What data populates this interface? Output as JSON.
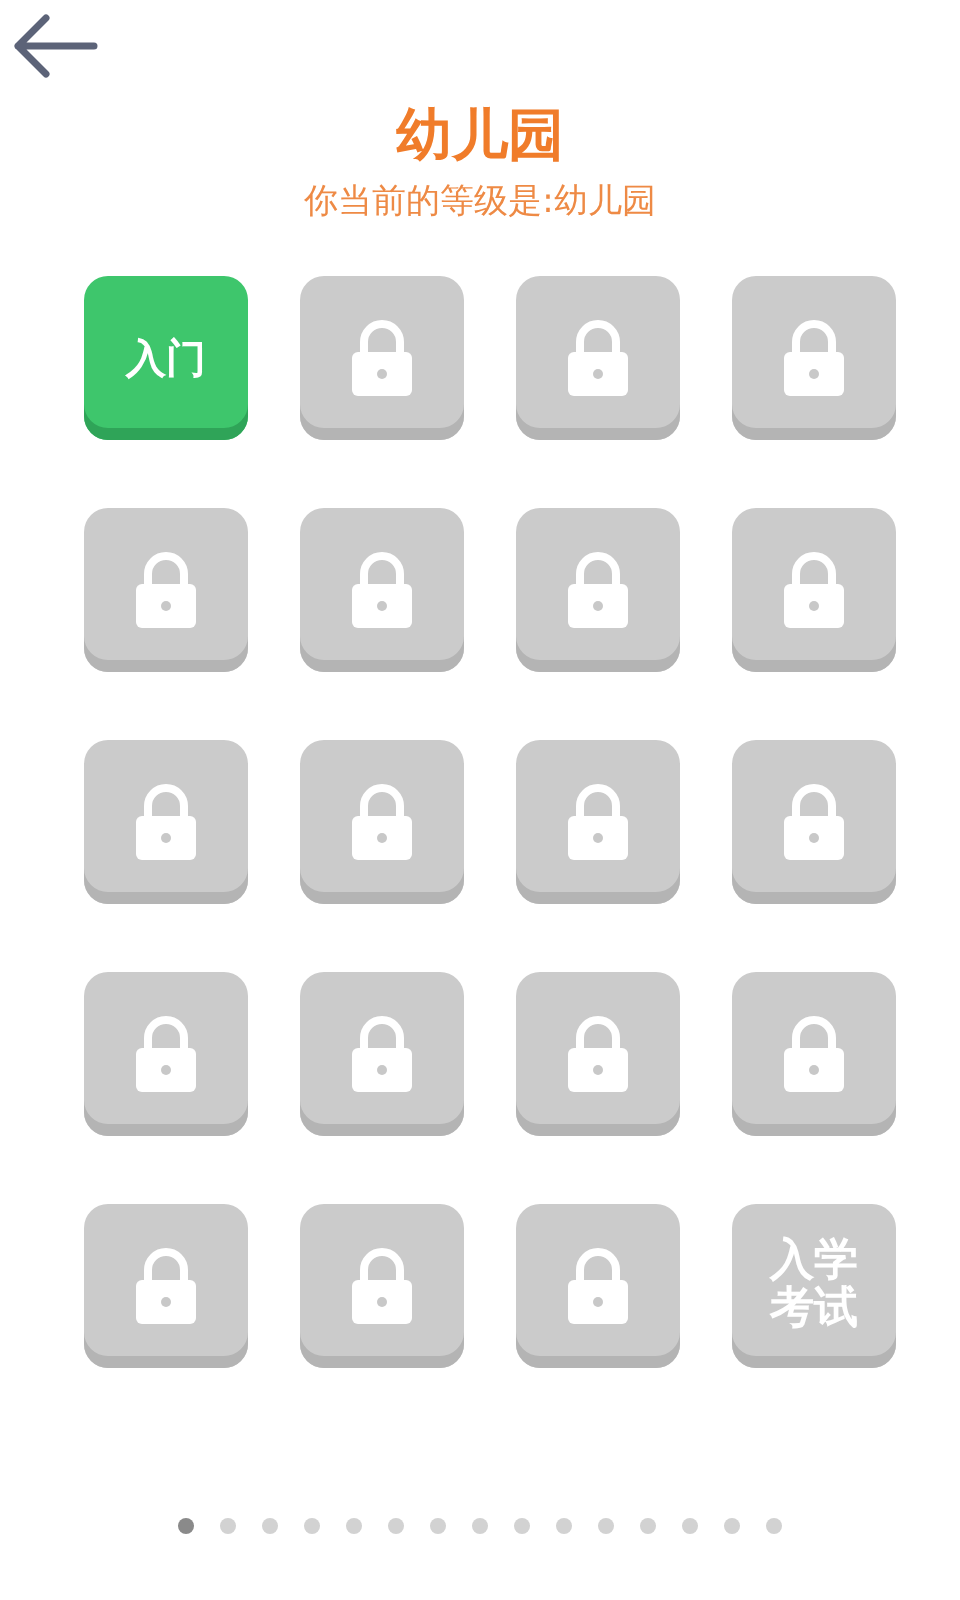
{
  "header": {
    "title": "幼儿园",
    "subtitle": "你当前的等级是:幼儿园"
  },
  "tiles": [
    {
      "kind": "level",
      "label": "入门",
      "locked": false
    },
    {
      "kind": "level",
      "locked": true
    },
    {
      "kind": "level",
      "locked": true
    },
    {
      "kind": "level",
      "locked": true
    },
    {
      "kind": "level",
      "locked": true
    },
    {
      "kind": "level",
      "locked": true
    },
    {
      "kind": "level",
      "locked": true
    },
    {
      "kind": "level",
      "locked": true
    },
    {
      "kind": "level",
      "locked": true
    },
    {
      "kind": "level",
      "locked": true
    },
    {
      "kind": "level",
      "locked": true
    },
    {
      "kind": "level",
      "locked": true
    },
    {
      "kind": "level",
      "locked": true
    },
    {
      "kind": "level",
      "locked": true
    },
    {
      "kind": "level",
      "locked": true
    },
    {
      "kind": "level",
      "locked": true
    },
    {
      "kind": "level",
      "locked": true
    },
    {
      "kind": "level",
      "locked": true
    },
    {
      "kind": "level",
      "locked": true
    },
    {
      "kind": "exam",
      "label": "入学考试",
      "locked": true
    }
  ],
  "pages": [
    {
      "selected": true
    },
    {
      "selected": false
    },
    {
      "selected": false
    },
    {
      "selected": false
    },
    {
      "selected": false
    },
    {
      "selected": false
    },
    {
      "selected": false
    },
    {
      "selected": false
    },
    {
      "selected": false
    },
    {
      "selected": false
    },
    {
      "selected": false
    },
    {
      "selected": false
    },
    {
      "selected": false
    },
    {
      "selected": false
    },
    {
      "selected": false
    }
  ]
}
